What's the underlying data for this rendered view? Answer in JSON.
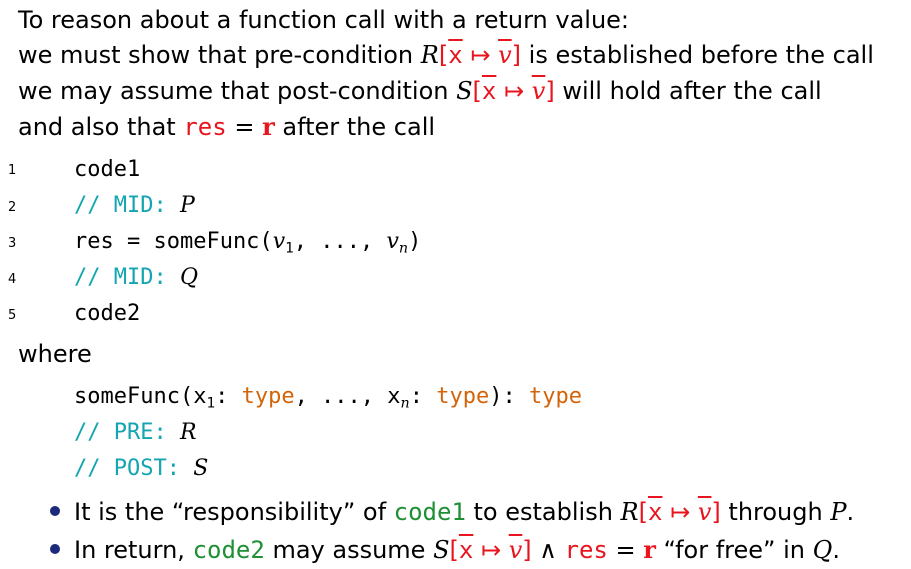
{
  "intro": {
    "line1": "To reason about a function call with a return value:",
    "line2_pre": "we must show that pre-condition ",
    "line2_post": " is established before the call",
    "line3_pre": "we may assume that post-condition ",
    "line3_post": " will hold after the call",
    "line4_pre": "and also that ",
    "line4_post": " after the call"
  },
  "subst": {
    "R": "R",
    "S": "S",
    "x": "x",
    "maps": "↦",
    "v": "v"
  },
  "res_eq": {
    "res": "res",
    "eq": " = ",
    "r": "r"
  },
  "listing": {
    "numbers": [
      "1",
      "2",
      "3",
      "4",
      "5"
    ],
    "code1": "code1",
    "mid_label": "// MID: ",
    "mid_p": "P",
    "call_pre": "res = someFunc(",
    "v1": "v",
    "sub1": "1",
    "dots": ", ..., ",
    "vn": "v",
    "subn": "n",
    "close": ")",
    "mid_q": "Q",
    "code2": "code2"
  },
  "where": "where",
  "signature": {
    "name": "someFunc(",
    "x1": "x",
    "sub1": "1",
    "colon": ": ",
    "type": "type",
    "dots": ", ..., ",
    "xn": "x",
    "subn": "n",
    "close": "): ",
    "pre_label": "// PRE: ",
    "pre_R": "R",
    "post_label": "// POST: ",
    "post_S": "S"
  },
  "bullets": {
    "b1_pre": "It is the “responsibility” of ",
    "b1_code": "code1",
    "b1_mid": " to establish ",
    "b1_post": " through ",
    "b1_P": "P",
    "b1_end": ".",
    "b2_pre": "In return, ",
    "b2_code": "code2",
    "b2_mid": " may assume ",
    "b2_and": " ∧ ",
    "b2_post": " “for free” in ",
    "b2_Q": "Q",
    "b2_end": "."
  },
  "colors": {
    "red": "#e8141e",
    "green": "#1f8f34",
    "teal": "#14a5b0",
    "orange": "#d4640a",
    "bullet": "#1b2a7a"
  }
}
